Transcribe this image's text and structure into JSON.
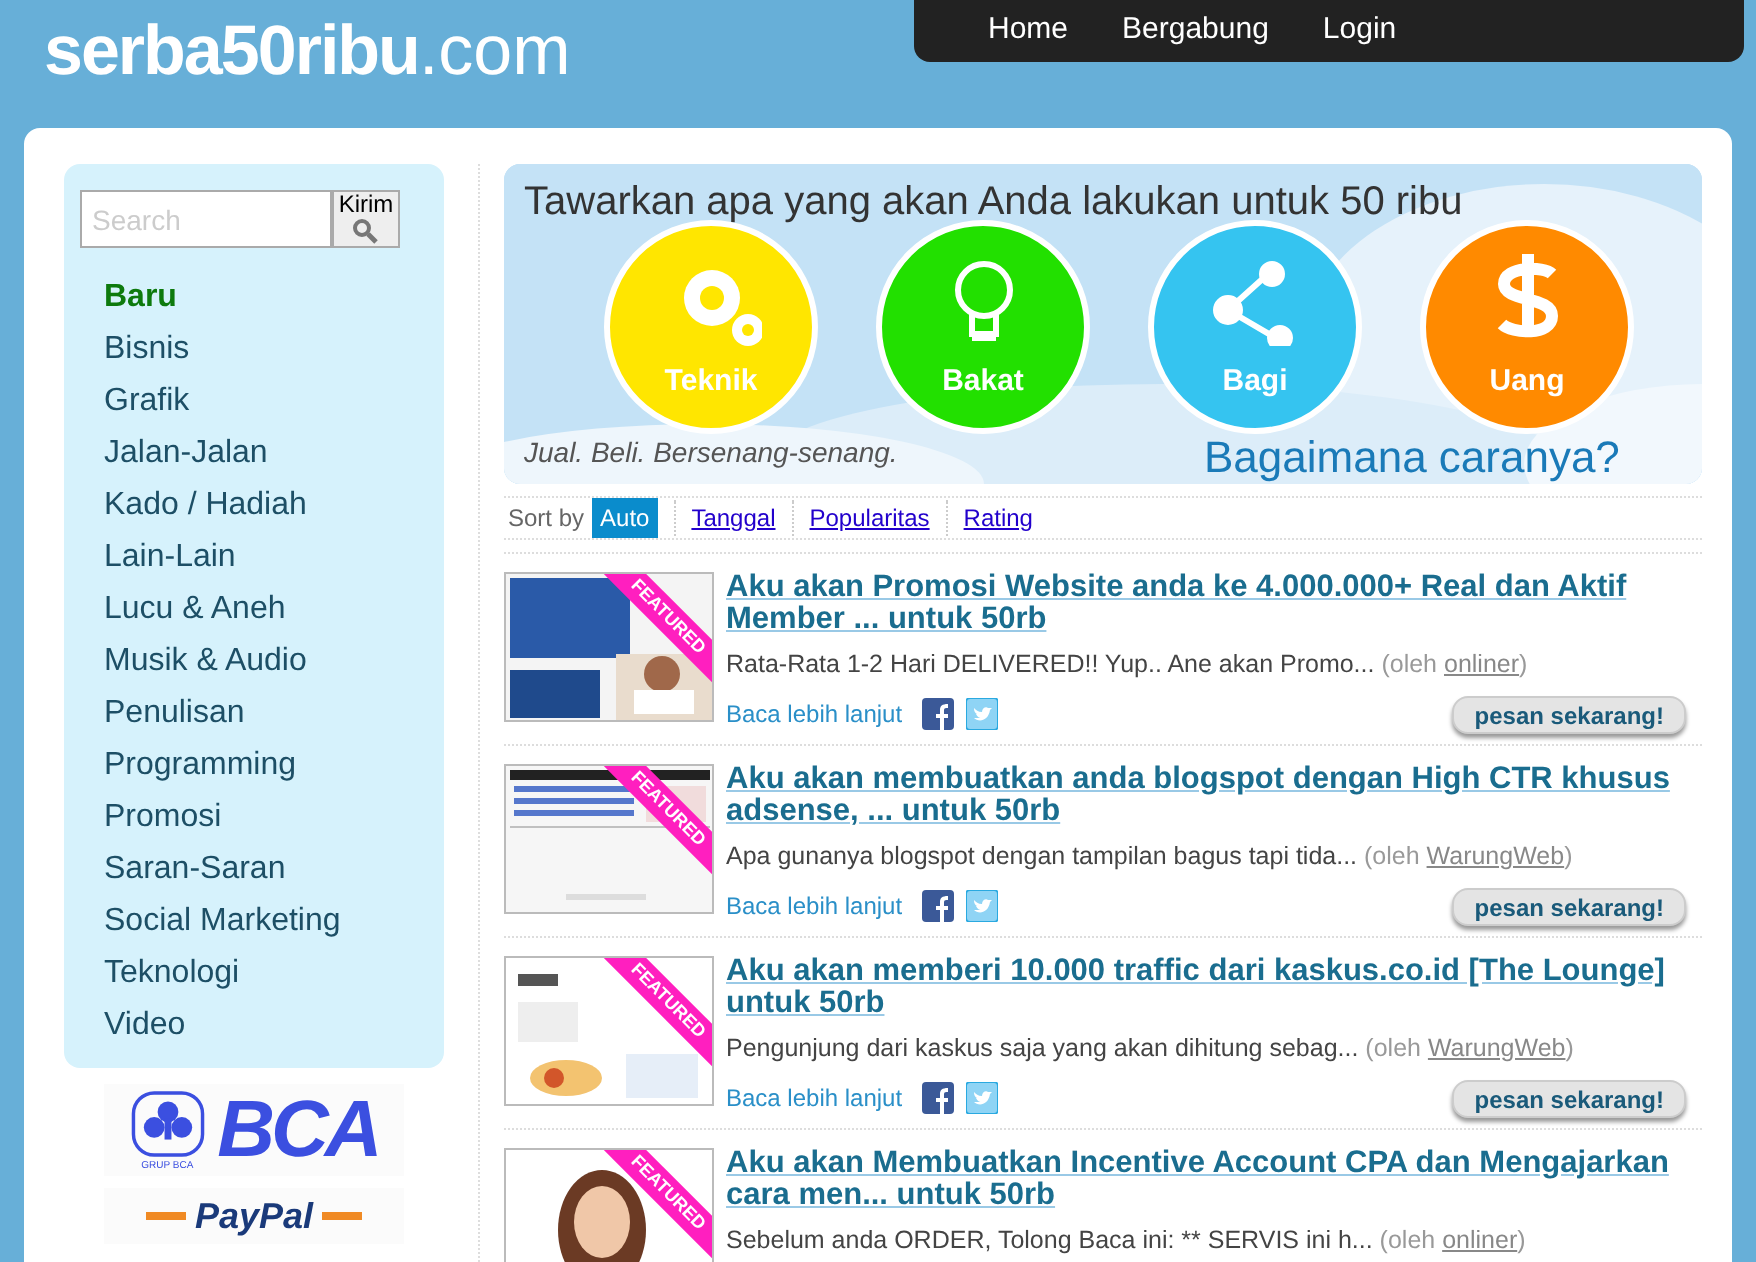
{
  "logo": {
    "name": "serba50ribu",
    "suffix": ".com"
  },
  "nav": [
    "Home",
    "Bergabung",
    "Login"
  ],
  "search": {
    "placeholder": "Search",
    "button": "Kirim"
  },
  "categories": [
    {
      "label": "Baru",
      "selected": true
    },
    {
      "label": "Bisnis",
      "selected": false
    },
    {
      "label": "Grafik",
      "selected": false
    },
    {
      "label": "Jalan-Jalan",
      "selected": false
    },
    {
      "label": "Kado / Hadiah",
      "selected": false
    },
    {
      "label": "Lain-Lain",
      "selected": false
    },
    {
      "label": "Lucu & Aneh",
      "selected": false
    },
    {
      "label": "Musik & Audio",
      "selected": false
    },
    {
      "label": "Penulisan",
      "selected": false
    },
    {
      "label": "Programming",
      "selected": false
    },
    {
      "label": "Promosi",
      "selected": false
    },
    {
      "label": "Saran-Saran",
      "selected": false
    },
    {
      "label": "Social Marketing",
      "selected": false
    },
    {
      "label": "Teknologi",
      "selected": false
    },
    {
      "label": "Video",
      "selected": false
    }
  ],
  "payment_logos": [
    {
      "kind": "bca",
      "text": "BCA",
      "subtext": "GRUP BCA"
    },
    {
      "kind": "paypal",
      "text": "PayPal"
    }
  ],
  "banner": {
    "title": "Tawarkan apa yang akan Anda lakukan untuk 50 ribu",
    "tagline": "Jual. Beli. Bersenang-senang.",
    "link": "Bagaimana caranya?",
    "circles": [
      {
        "label": "Teknik",
        "kind": "gears",
        "color": "#ffe600"
      },
      {
        "label": "Bakat",
        "kind": "bulb",
        "color": "#22e000"
      },
      {
        "label": "Bagi",
        "kind": "share",
        "color": "#35c4f0"
      },
      {
        "label": "Uang",
        "kind": "dollar",
        "color": "#ff8a00"
      }
    ]
  },
  "sort": {
    "label": "Sort by",
    "options": [
      {
        "label": "Auto",
        "selected": true
      },
      {
        "label": "Tanggal",
        "selected": false
      },
      {
        "label": "Popularitas",
        "selected": false
      },
      {
        "label": "Rating",
        "selected": false
      }
    ]
  },
  "listings": [
    {
      "title": "Aku akan Promosi Website anda ke 4.000.000+ Real dan Aktif Member ... untuk 50rb",
      "description": "Rata-Rata 1-2 Hari DELIVERED!! Yup.. Ane akan Promo...",
      "by": "(oleh",
      "author": "onliner",
      "close": ")",
      "badge": "FEATURED",
      "read_more": "Baca lebih lanjut",
      "order": "pesan sekarang!"
    },
    {
      "title": "Aku akan membuatkan anda blogspot dengan High CTR khusus adsense, ... untuk 50rb",
      "description": "Apa gunanya blogspot dengan tampilan bagus tapi tida...",
      "by": "(oleh",
      "author": "WarungWeb",
      "close": ")",
      "badge": "FEATURED",
      "read_more": "Baca lebih lanjut",
      "order": "pesan sekarang!"
    },
    {
      "title": "Aku akan memberi 10.000 traffic dari kaskus.co.id [The Lounge] untuk 50rb",
      "description": "Pengunjung dari kaskus saja yang akan dihitung sebag...",
      "by": "(oleh",
      "author": "WarungWeb",
      "close": ")",
      "badge": "FEATURED",
      "read_more": "Baca lebih lanjut",
      "order": "pesan sekarang!"
    },
    {
      "title": "Aku akan Membuatkan Incentive Account CPA dan Mengajarkan cara men... untuk 50rb",
      "description": "Sebelum anda ORDER, Tolong Baca ini: ** SERVIS ini h...",
      "by": "(oleh",
      "author": "onliner",
      "close": ")",
      "badge": "FEATURED"
    }
  ]
}
